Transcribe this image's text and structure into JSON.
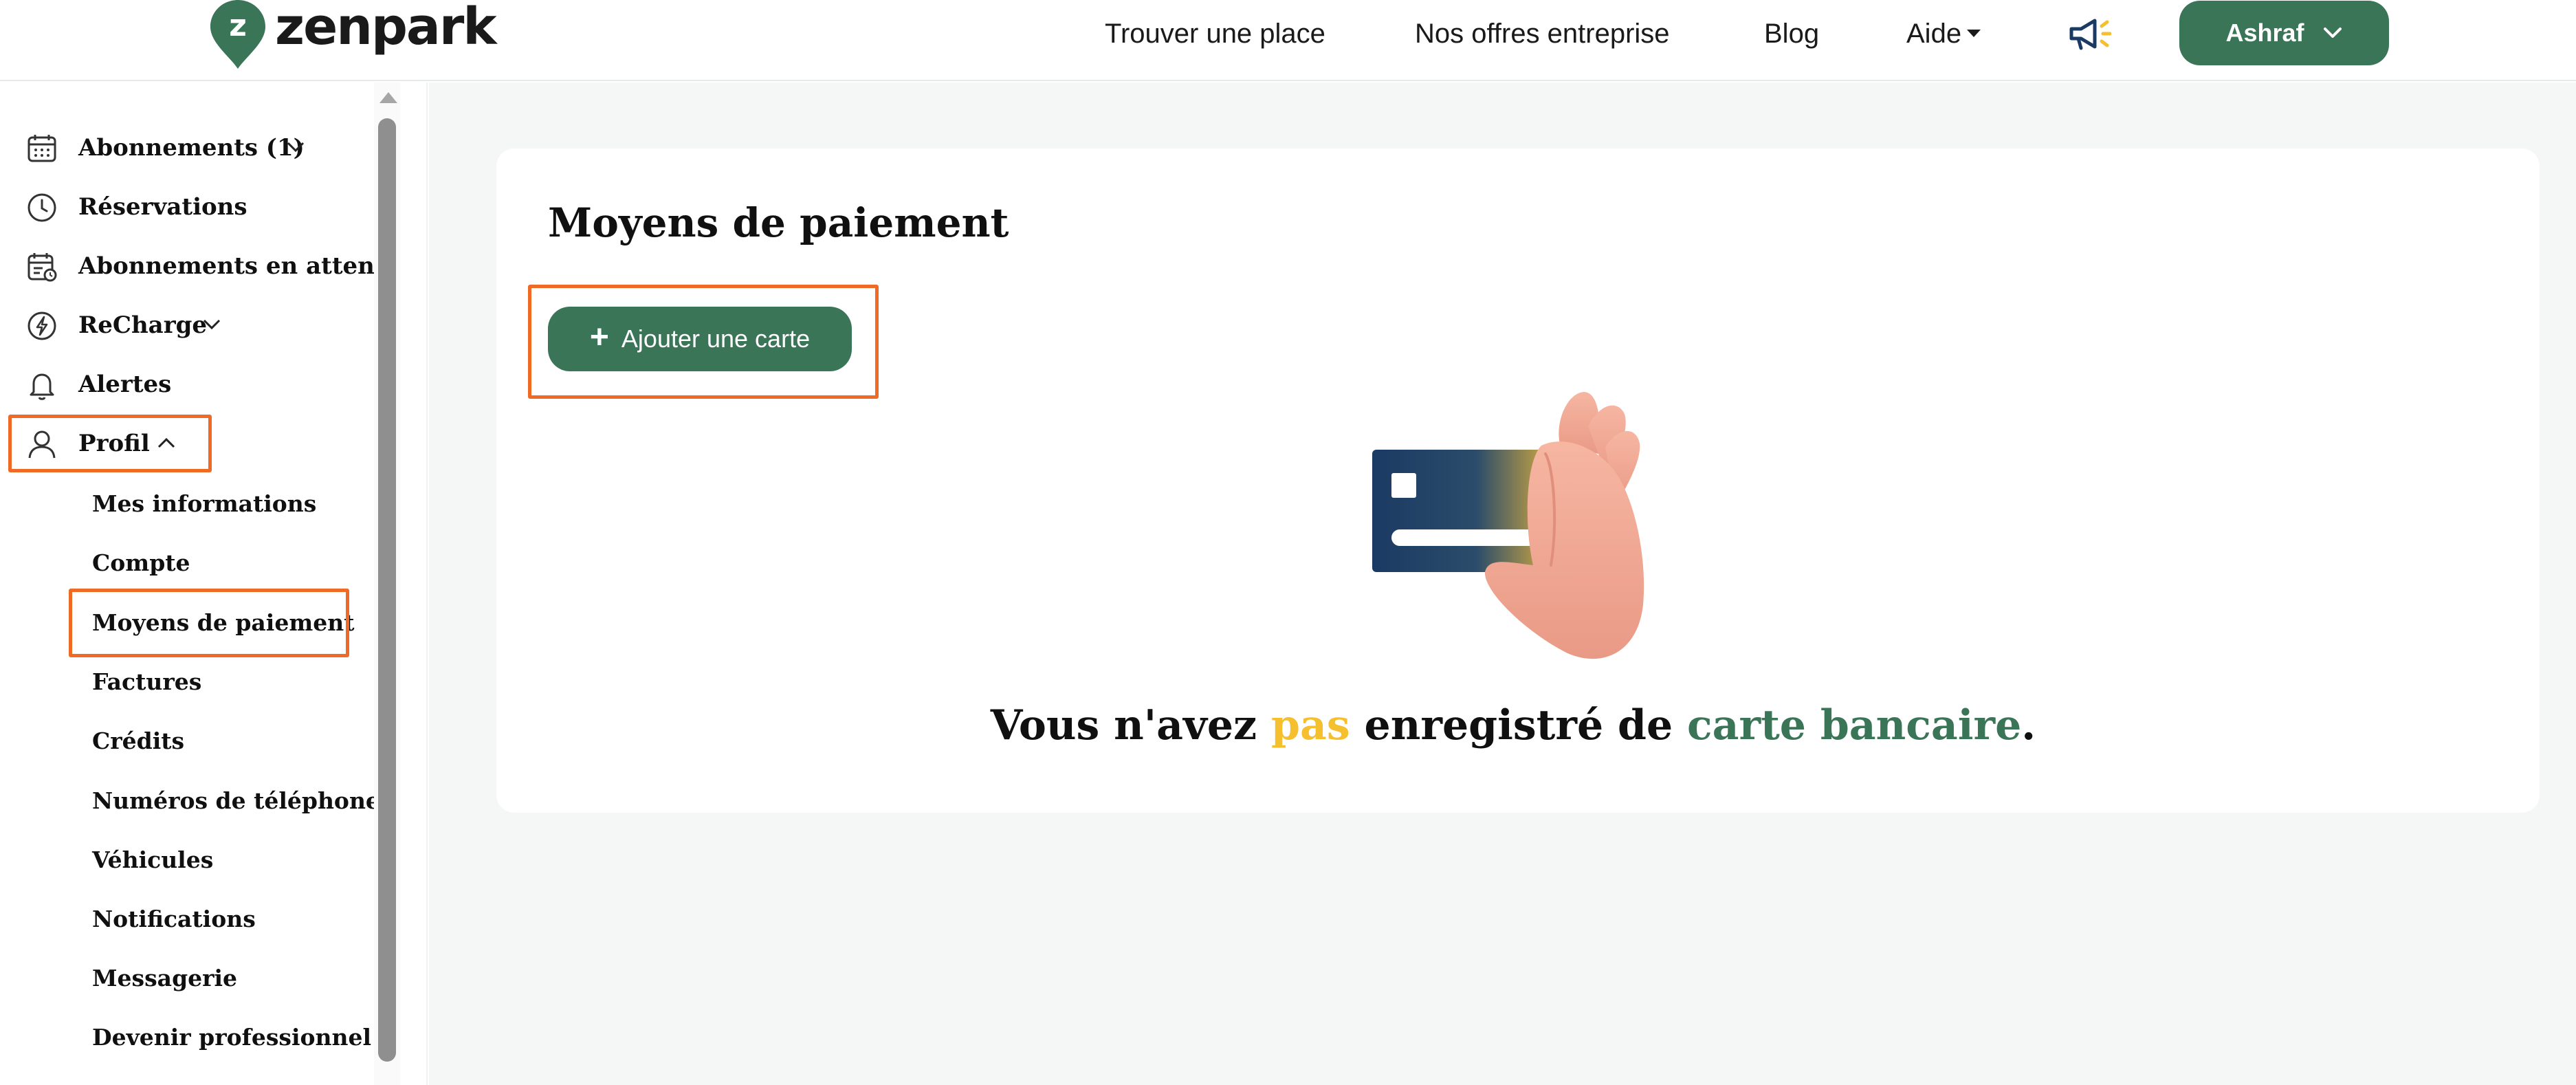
{
  "brand": {
    "name": "zenpark",
    "pin_letter": "z"
  },
  "nav": {
    "find_place": "Trouver une place",
    "business_offers": "Nos offres entreprise",
    "blog": "Blog",
    "help": "Aide",
    "user_name": "Ashraf"
  },
  "sidebar": {
    "items": [
      {
        "label": "Abonnements (1)",
        "icon": "calendar-icon"
      },
      {
        "label": "Réservations",
        "icon": "clock-icon"
      },
      {
        "label": "Abonnements en attente",
        "icon": "calendar-pending-icon"
      },
      {
        "label": "ReCharge",
        "icon": "bolt-icon"
      },
      {
        "label": "Alertes",
        "icon": "bell-icon"
      },
      {
        "label": "Profil",
        "icon": "user-icon"
      }
    ],
    "profile_sub": [
      "Mes informations",
      "Compte",
      "Moyens de paiement",
      "Factures",
      "Crédits",
      "Numéros de téléphone",
      "Véhicules",
      "Notifications",
      "Messagerie",
      "Devenir professionnel"
    ]
  },
  "main": {
    "title": "Moyens de paiement",
    "add_card": "Ajouter une carte",
    "empty": {
      "part1": "Vous n'avez ",
      "part2": "pas",
      "part3": " enregistré de ",
      "part4": "carte bancaire",
      "part5": "."
    }
  },
  "colors": {
    "brand_green": "#3a7558",
    "accent_yellow": "#f5bf2d",
    "highlight_orange": "#ef6a25",
    "card_navy": "#1b3a63"
  }
}
